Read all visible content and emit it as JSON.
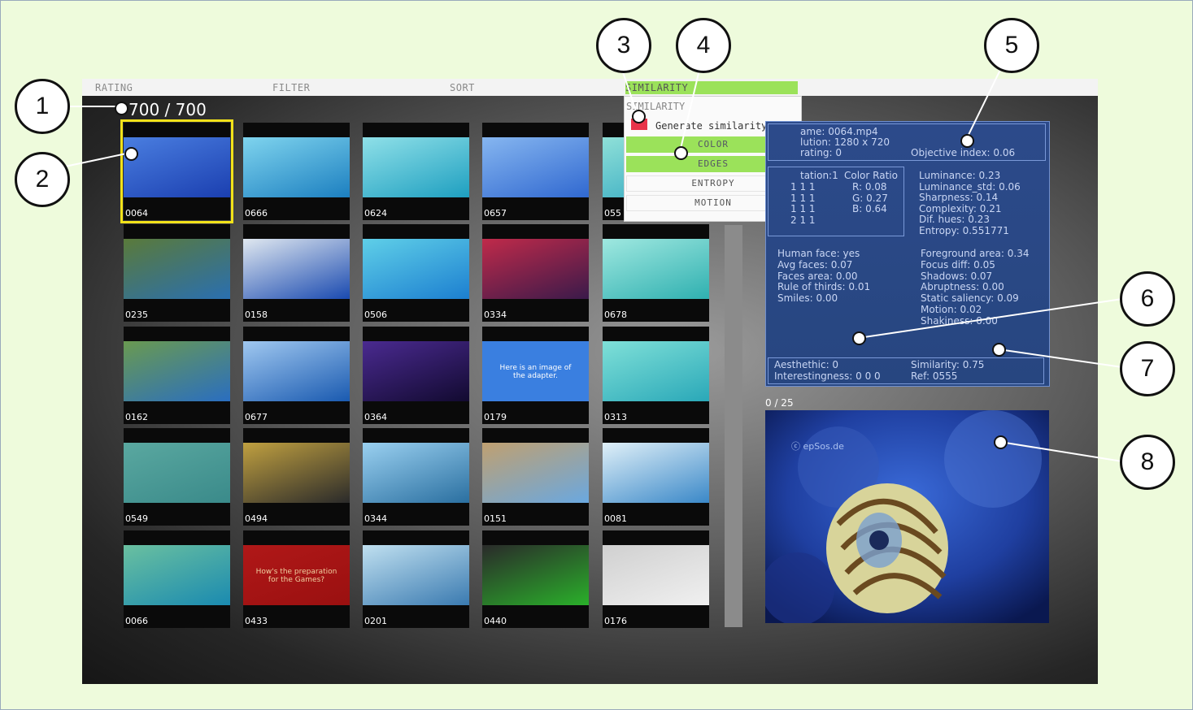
{
  "menu": [
    "RATING",
    "FILTER",
    "SORT",
    "SIMILARITY"
  ],
  "counter": "700 / 700",
  "thumbnails": [
    "0064",
    "0666",
    "0624",
    "0657",
    "055",
    "0235",
    "0158",
    "0506",
    "0334",
    "0678",
    "0162",
    "0677",
    "0364",
    "0179",
    "0313",
    "0549",
    "0494",
    "0344",
    "0151",
    "0081",
    "0066",
    "0433",
    "0201",
    "0440",
    "0176"
  ],
  "thumb_texts": {
    "0179": "Here is an image of\nthe adapter.",
    "0433": "How's the preparation\nfor the Games?"
  },
  "dropdown": {
    "title": "SIMILARITY",
    "checkbox_label": "Generate similarity",
    "options": [
      {
        "label": "COLOR",
        "on": true
      },
      {
        "label": "EDGES",
        "on": true
      },
      {
        "label": "ENTROPY",
        "on": false
      },
      {
        "label": "MOTION",
        "on": false
      }
    ]
  },
  "info": {
    "frame": "ame: 0064.mp4",
    "resolution": "lution: 1280 x 720",
    "rating": "rating: 0",
    "objective_index": "Objective index: 0.06",
    "rotation_header": "tation:1",
    "rotation_rows": [
      "1   1   1",
      "1   1   1",
      "1   1   1",
      "2   1   1"
    ],
    "color_ratio_header": "Color Ratio",
    "color_ratio": [
      "R: 0.08",
      "G: 0.27",
      "B: 0.64"
    ],
    "metrics_right_top": [
      "Luminance: 0.23",
      "Luminance_std: 0.06",
      "Sharpness: 0.14",
      "Complexity: 0.21",
      "Dif. hues: 0.23",
      "Entropy: 0.551771"
    ],
    "metrics_left": [
      "Human face: yes",
      "Avg faces: 0.07",
      "Faces area: 0.00",
      "Rule of thirds: 0.01",
      "Smiles: 0.00"
    ],
    "metrics_right": [
      "Foreground area: 0.34",
      "Focus diff: 0.05",
      "Shadows: 0.07",
      "Abruptness: 0.00",
      "Static saliency: 0.09",
      "Motion: 0.02",
      "Shakiness: 0.00"
    ],
    "aesthetic": "Aesthethic: 0",
    "interestingness": "Interestingness: 0 0 0",
    "similarity": "Similarity: 0.75",
    "ref": "Ref: 0555"
  },
  "preview": {
    "count": "0 / 25",
    "watermark": "ⓒ epSos.de"
  },
  "callouts": [
    "1",
    "2",
    "3",
    "4",
    "5",
    "6",
    "7",
    "8"
  ]
}
